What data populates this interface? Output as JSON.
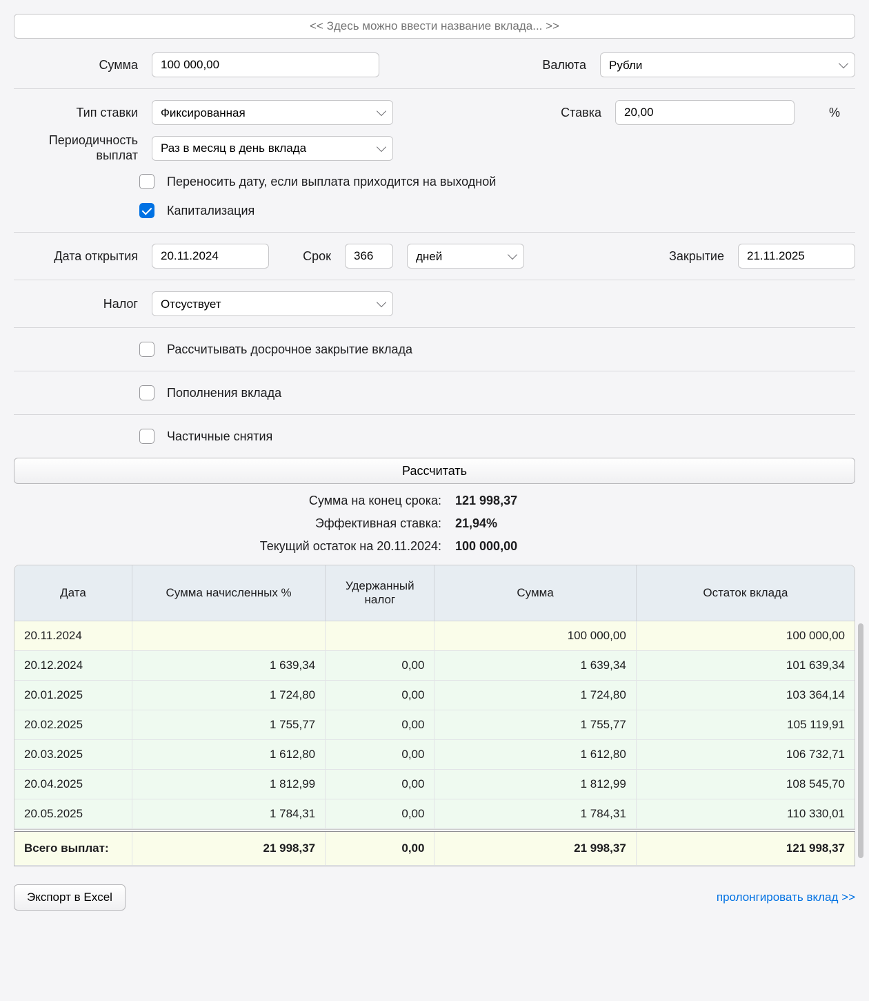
{
  "title_placeholder": "<< Здесь можно ввести название вклада... >>",
  "currency_label": "Валюта",
  "currency_value": "Рубли",
  "amount_label": "Сумма",
  "amount_value": "100 000,00",
  "rate_type_label": "Тип ставки",
  "rate_type_value": "Фиксированная",
  "rate_label": "Ставка",
  "rate_value": "20,00",
  "percent": "%",
  "payout_freq_label": "Периодичность выплат",
  "payout_freq_value": "Раз в месяц в день вклада",
  "weekend_shift_label": "Переносить дату, если выплата приходится на выходной",
  "capitalization_label": "Капитализация",
  "open_date_label": "Дата открытия",
  "open_date_value": "20.11.2024",
  "term_label": "Срок",
  "term_value": "366",
  "term_unit_value": "дней",
  "close_label": "Закрытие",
  "close_value": "21.11.2025",
  "tax_label": "Налог",
  "tax_value": "Отсуствует",
  "early_close_label": "Рассчитывать досрочное закрытие вклада",
  "topups_label": "Пополнения вклада",
  "withdrawals_label": "Частичные снятия",
  "calc_btn": "Рассчитать",
  "summary": {
    "end_amount_label": "Сумма на конец срока:",
    "end_amount_value": "121 998,37",
    "eff_rate_label": "Эффективная ставка:",
    "eff_rate_value": "21,94%",
    "current_balance_label": "Текущий остаток на 20.11.2024:",
    "current_balance_value": "100 000,00"
  },
  "table": {
    "headers": {
      "date": "Дата",
      "accrued": "Сумма начисленных %",
      "tax": "Удержанный налог",
      "sum": "Сумма",
      "balance": "Остаток вклада"
    },
    "rows": [
      {
        "date": "20.11.2024",
        "accrued": "",
        "tax": "",
        "sum": "100 000,00",
        "balance": "100 000,00"
      },
      {
        "date": "20.12.2024",
        "accrued": "1 639,34",
        "tax": "0,00",
        "sum": "1 639,34",
        "balance": "101 639,34"
      },
      {
        "date": "20.01.2025",
        "accrued": "1 724,80",
        "tax": "0,00",
        "sum": "1 724,80",
        "balance": "103 364,14"
      },
      {
        "date": "20.02.2025",
        "accrued": "1 755,77",
        "tax": "0,00",
        "sum": "1 755,77",
        "balance": "105 119,91"
      },
      {
        "date": "20.03.2025",
        "accrued": "1 612,80",
        "tax": "0,00",
        "sum": "1 612,80",
        "balance": "106 732,71"
      },
      {
        "date": "20.04.2025",
        "accrued": "1 812,99",
        "tax": "0,00",
        "sum": "1 812,99",
        "balance": "108 545,70"
      },
      {
        "date": "20.05.2025",
        "accrued": "1 784,31",
        "tax": "0,00",
        "sum": "1 784,31",
        "balance": "110 330,01"
      }
    ],
    "totals": {
      "label": "Всего выплат:",
      "accrued": "21 998,37",
      "tax": "0,00",
      "sum": "21 998,37",
      "balance": "121 998,37"
    }
  },
  "export_btn": "Экспорт в Excel",
  "prolong_link": "пролонгировать вклад >>"
}
